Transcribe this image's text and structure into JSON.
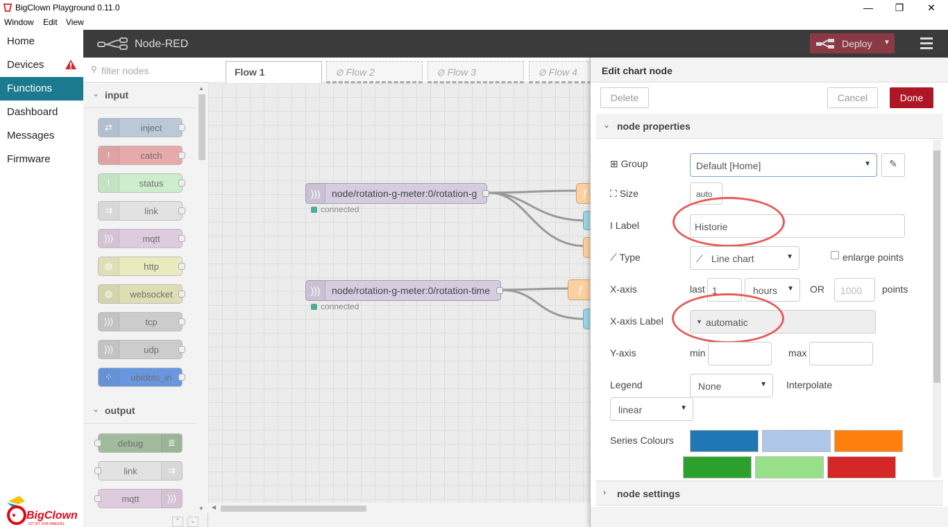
{
  "window": {
    "title": "BigClown Playground 0.11.0",
    "menu": [
      "Window",
      "Edit",
      "View"
    ],
    "min": "—",
    "restore": "❐",
    "close": "✕"
  },
  "nav": {
    "items": [
      "Home",
      "Devices",
      "Functions",
      "Dashboard",
      "Messages",
      "Firmware"
    ],
    "active": "Functions",
    "warning": "!",
    "brand": "BigClown",
    "tagline": "IOT KIT FOR MAKERS"
  },
  "header": {
    "brand": "Node-RED",
    "deploy": "Deploy"
  },
  "palette": {
    "filter_placeholder": "filter nodes",
    "input_title": "input",
    "input_nodes": [
      {
        "label": "inject",
        "color": "#a6bbcf",
        "icon": "⇄"
      },
      {
        "label": "catch",
        "color": "#e49191",
        "icon": "!"
      },
      {
        "label": "status",
        "color": "#c0edc0",
        "icon": "!"
      },
      {
        "label": "link",
        "color": "#dddddd",
        "icon": "⇉"
      },
      {
        "label": "mqtt",
        "color": "#d8bfd8",
        "icon": ")))"
      },
      {
        "label": "http",
        "color": "#e7e7ae",
        "icon": "◍"
      },
      {
        "label": "websocket",
        "color": "#d7d7a0",
        "icon": "◍"
      },
      {
        "label": "tcp",
        "color": "#c0c0c0",
        "icon": ")))"
      },
      {
        "label": "udp",
        "color": "#c0c0c0",
        "icon": ")))"
      },
      {
        "label": "ubidots_in",
        "color": "#3b79d9",
        "icon": "⁘"
      }
    ],
    "output_title": "output",
    "output_nodes": [
      {
        "label": "debug",
        "color": "#87a980",
        "icon": "≣"
      },
      {
        "label": "link",
        "color": "#dddddd",
        "icon": "⇉"
      },
      {
        "label": "mqtt",
        "color": "#d8bfd8",
        "icon": ")))"
      }
    ]
  },
  "tabs": [
    {
      "label": "Flow 1",
      "disabled": false
    },
    {
      "label": "⊘ Flow 2",
      "disabled": true
    },
    {
      "label": "⊘ Flow 3",
      "disabled": true
    },
    {
      "label": "⊘ Flow 4",
      "disabled": true
    }
  ],
  "flow": {
    "node1": {
      "label": "node/rotation-g-meter:0/rotation-g",
      "status": "connected"
    },
    "node2": {
      "label": "node/rotation-g-meter:0/rotation-time",
      "status": "connected"
    }
  },
  "editor": {
    "title": "Edit chart node",
    "delete": "Delete",
    "cancel": "Cancel",
    "done": "Done",
    "section_properties": "node properties",
    "section_settings": "node settings",
    "group_label": "Group",
    "group_value": "Default [Home]",
    "size_label": "Size",
    "size_value": "auto",
    "label_label": "Label",
    "label_value": "Historie",
    "type_label": "Type",
    "type_value": "Line chart",
    "enlarge_points": "enlarge points",
    "xaxis_label": "X-axis",
    "last": "last",
    "last_value": "1",
    "unit_value": "hours",
    "or": "OR",
    "points_placeholder": "1000",
    "points": "points",
    "xaxis_label_label": "X-axis Label",
    "xaxis_label_value": "automatic",
    "yaxis_label": "Y-axis",
    "min": "min",
    "max": "max",
    "legend_label": "Legend",
    "legend_value": "None",
    "interpolate_label": "Interpolate",
    "interpolate_value": "linear",
    "series_colours_label": "Series Colours",
    "colours": [
      "#1f77b4",
      "#aec7e8",
      "#ff7f0e",
      "#2ca02c",
      "#98df8a",
      "#d62728"
    ]
  }
}
